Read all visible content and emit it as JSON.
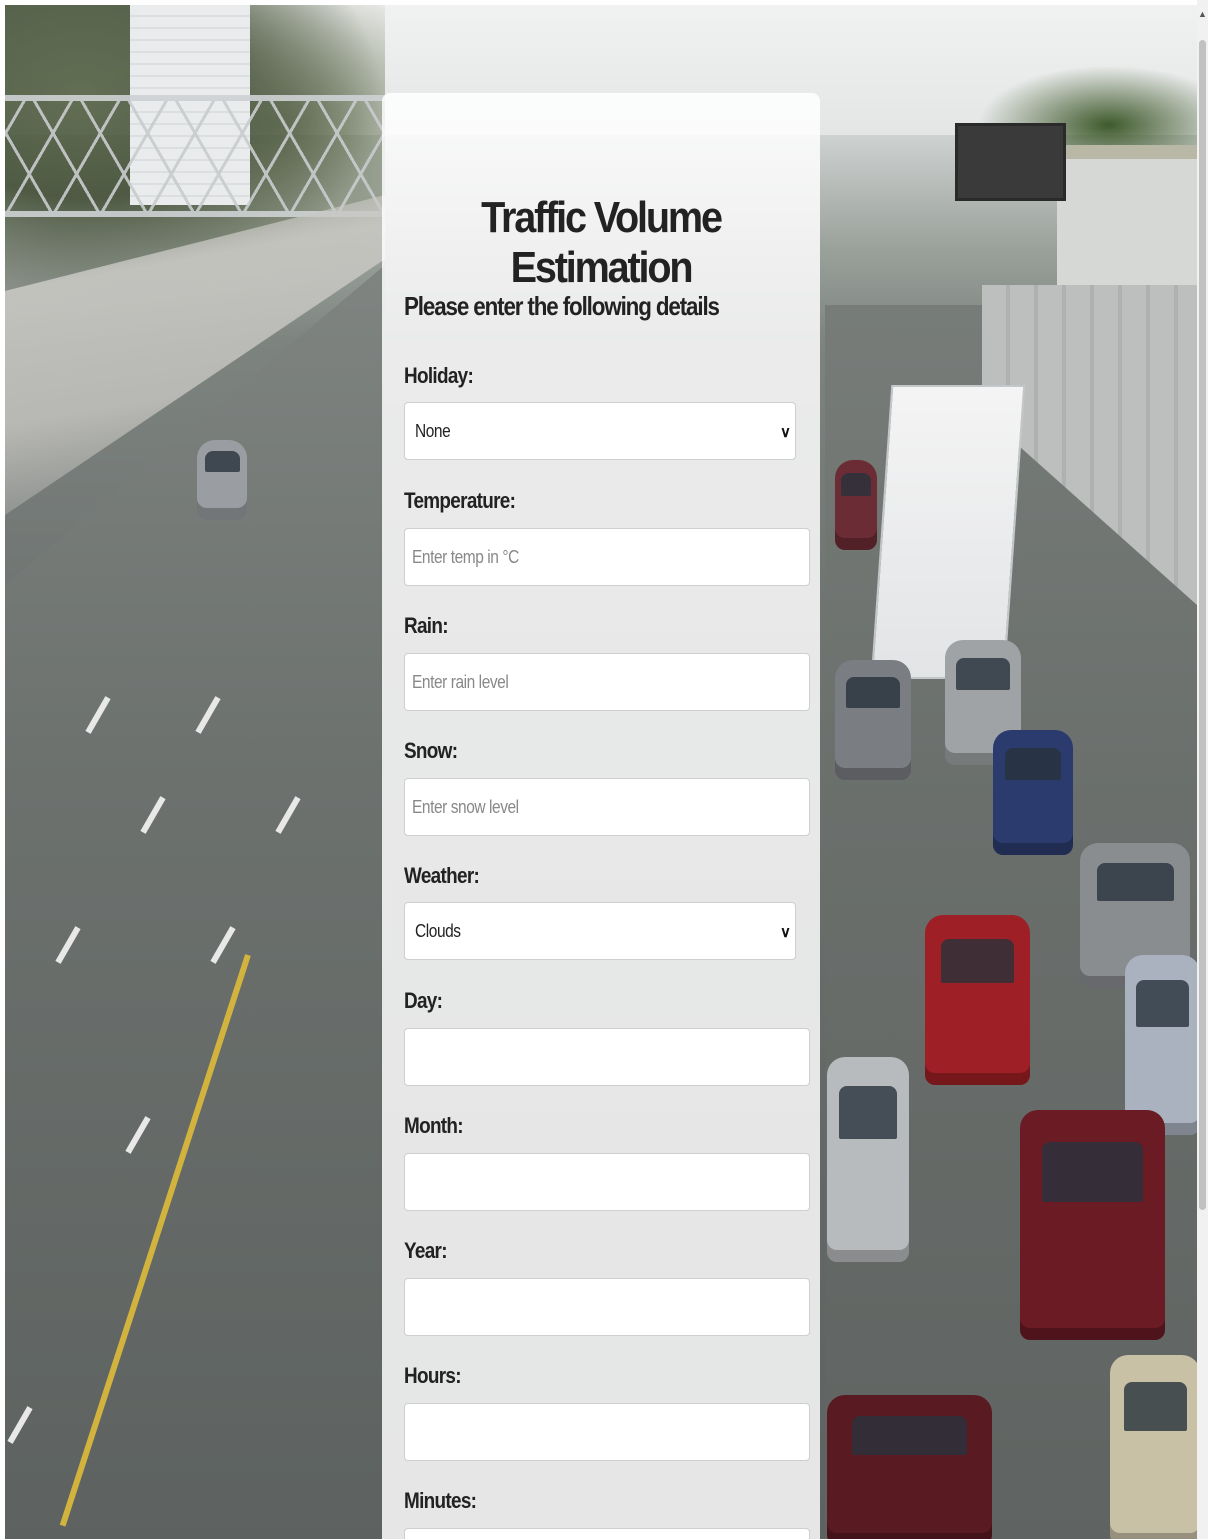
{
  "form": {
    "title": "Traffic Volume Estimation",
    "subtitle": "Please enter the following details",
    "fields": [
      {
        "label": "Holiday:",
        "type": "select",
        "value": "None"
      },
      {
        "label": "Temperature:",
        "type": "input",
        "placeholder": "Enter temp in °C"
      },
      {
        "label": "Rain:",
        "type": "input",
        "placeholder": "Enter rain level"
      },
      {
        "label": "Snow:",
        "type": "input",
        "placeholder": "Enter snow level"
      },
      {
        "label": "Weather:",
        "type": "select",
        "value": "Clouds"
      },
      {
        "label": "Day:",
        "type": "input",
        "placeholder": ""
      },
      {
        "label": "Month:",
        "type": "input",
        "placeholder": ""
      },
      {
        "label": "Year:",
        "type": "input",
        "placeholder": ""
      },
      {
        "label": "Hours:",
        "type": "input",
        "placeholder": ""
      },
      {
        "label": "Minutes:",
        "type": "input",
        "placeholder": ""
      }
    ]
  },
  "icons": {
    "select_chevron": "chevron-down-icon",
    "scroll_up": "triangle-up-icon"
  },
  "colors": {
    "card_background": "#ffffff",
    "text": "#222222",
    "placeholder": "#888888"
  }
}
